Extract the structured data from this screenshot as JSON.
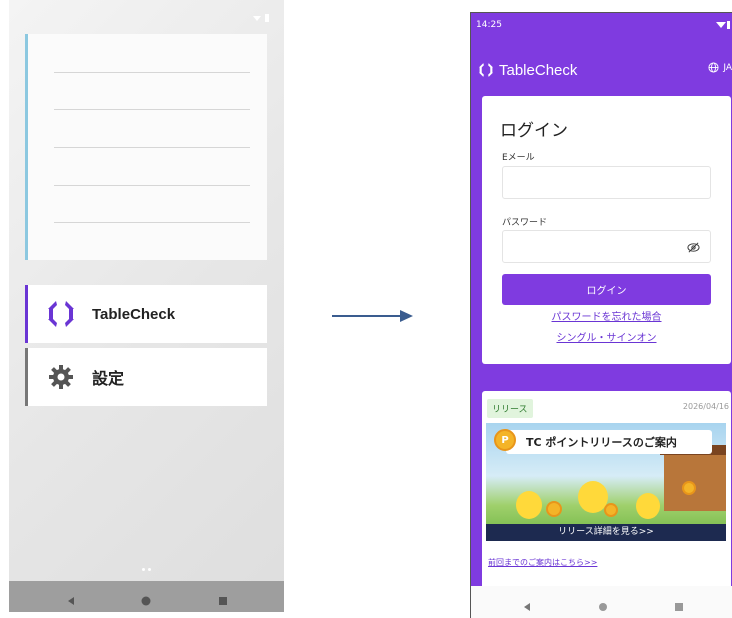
{
  "left_phone": {
    "launcher": [
      {
        "label": "TableCheck",
        "icon": "tablecheck-logo-icon"
      },
      {
        "label": "設定",
        "icon": "gear-icon"
      }
    ]
  },
  "right_phone": {
    "status_time": "14:25",
    "brand": "TableCheck",
    "language": "JA",
    "login": {
      "title": "ログイン",
      "email_label": "Eメール",
      "email_value": "",
      "password_label": "パスワード",
      "password_value": "",
      "submit_label": "ログイン",
      "forgot_link": "パスワードを忘れた場合",
      "sso_link": "シングル・サインオン"
    },
    "release": {
      "badge": "リリース",
      "date": "2026/04/16",
      "banner_title": "TC ポイントリリースのご案内",
      "banner_cta": "リリース詳細を見る>>",
      "previous_link": "前回までのご案内はこちら>>"
    }
  },
  "colors": {
    "brand_purple": "#7f3be0",
    "link_purple": "#6a35d4",
    "left_accent": "#8cc8e0"
  }
}
